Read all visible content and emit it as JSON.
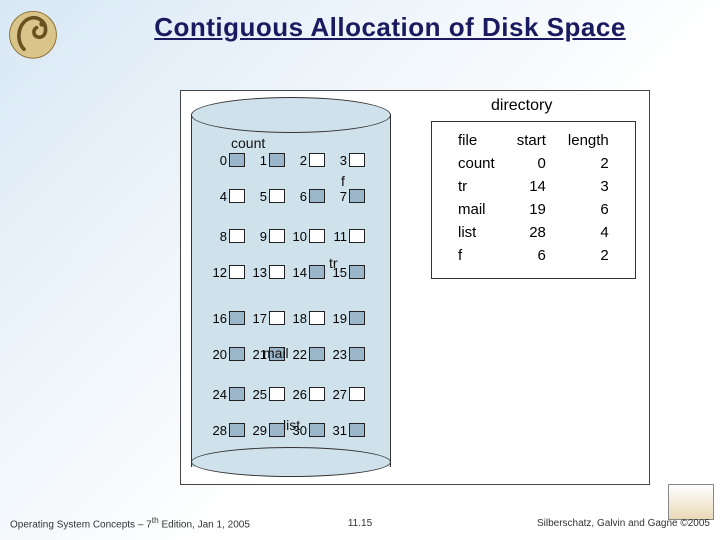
{
  "title": "Contiguous Allocation of Disk Space",
  "logo_name": "dinosaur-mascot",
  "disk": {
    "labels": {
      "count": "count",
      "f": "f",
      "tr": "tr",
      "mail": "mail",
      "list": "list"
    },
    "rows": [
      [
        {
          "n": "0",
          "a": true
        },
        {
          "n": "1",
          "a": true
        },
        {
          "n": "2",
          "a": false
        },
        {
          "n": "3",
          "a": false
        }
      ],
      [
        {
          "n": "4",
          "a": false
        },
        {
          "n": "5",
          "a": false
        },
        {
          "n": "6",
          "a": true
        },
        {
          "n": "7",
          "a": true
        }
      ],
      [
        {
          "n": "8",
          "a": false
        },
        {
          "n": "9",
          "a": false
        },
        {
          "n": "10",
          "a": false
        },
        {
          "n": "11",
          "a": false
        }
      ],
      [
        {
          "n": "12",
          "a": false
        },
        {
          "n": "13",
          "a": false
        },
        {
          "n": "14",
          "a": true
        },
        {
          "n": "15",
          "a": true
        }
      ],
      [
        {
          "n": "16",
          "a": true
        },
        {
          "n": "17",
          "a": false
        },
        {
          "n": "18",
          "a": false
        },
        {
          "n": "19",
          "a": true
        }
      ],
      [
        {
          "n": "20",
          "a": true
        },
        {
          "n": "21",
          "a": true
        },
        {
          "n": "22",
          "a": true
        },
        {
          "n": "23",
          "a": true
        }
      ],
      [
        {
          "n": "24",
          "a": true
        },
        {
          "n": "25",
          "a": false
        },
        {
          "n": "26",
          "a": false
        },
        {
          "n": "27",
          "a": false
        }
      ],
      [
        {
          "n": "28",
          "a": true
        },
        {
          "n": "29",
          "a": true
        },
        {
          "n": "30",
          "a": true
        },
        {
          "n": "31",
          "a": true
        }
      ]
    ]
  },
  "directory": {
    "label": "directory",
    "headers": {
      "file": "file",
      "start": "start",
      "length": "length"
    },
    "rows": [
      {
        "file": "count",
        "start": "0",
        "length": "2"
      },
      {
        "file": "tr",
        "start": "14",
        "length": "3"
      },
      {
        "file": "mail",
        "start": "19",
        "length": "6"
      },
      {
        "file": "list",
        "start": "28",
        "length": "4"
      },
      {
        "file": "f",
        "start": "6",
        "length": "2"
      }
    ]
  },
  "footer": {
    "left_a": "Operating System Concepts – 7",
    "left_sup": "th",
    "left_b": " Edition, Jan 1, 2005",
    "mid": "11.15",
    "right": "Silberschatz, Galvin and Gagne ©2005"
  }
}
